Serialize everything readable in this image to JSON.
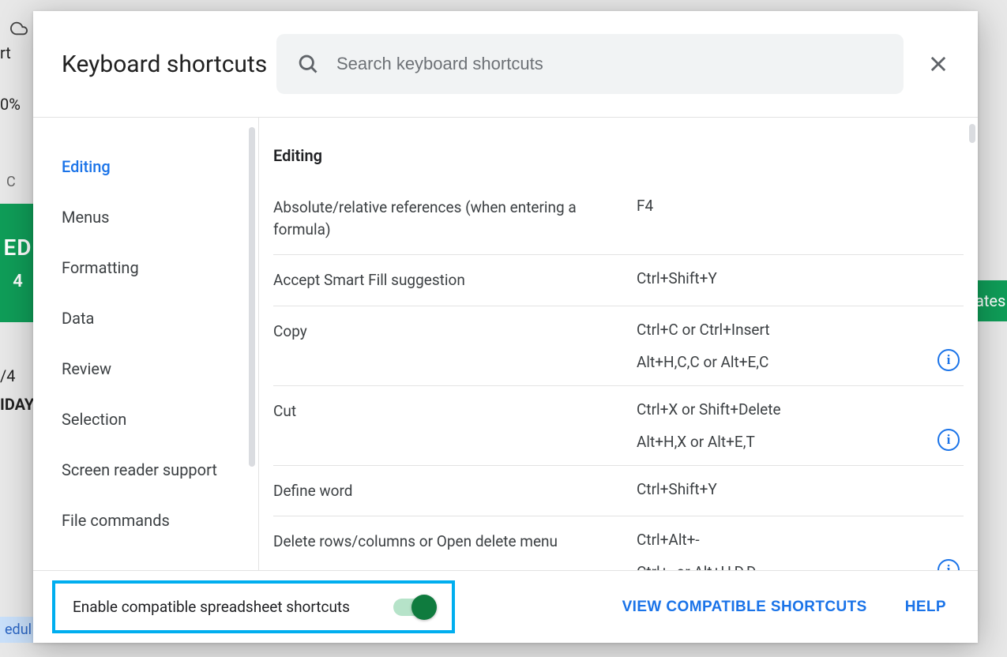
{
  "background": {
    "rt": "rt",
    "zoom": "0%",
    "ed": "ED",
    "num4": "4",
    "ates": "ates",
    "frac": "/4",
    "day": "IDAY",
    "c": "C",
    "edul": "edul"
  },
  "dialog": {
    "title": "Keyboard shortcuts",
    "search_placeholder": "Search keyboard shortcuts"
  },
  "sidebar": {
    "items": [
      {
        "label": "Editing",
        "active": true
      },
      {
        "label": "Menus",
        "active": false
      },
      {
        "label": "Formatting",
        "active": false
      },
      {
        "label": "Data",
        "active": false
      },
      {
        "label": "Review",
        "active": false
      },
      {
        "label": "Selection",
        "active": false
      },
      {
        "label": "Screen reader support",
        "active": false
      },
      {
        "label": "File commands",
        "active": false
      }
    ]
  },
  "content": {
    "section_title": "Editing",
    "shortcuts": [
      {
        "name": "Absolute/relative references (when entering a formula)",
        "keys": [
          "F4"
        ],
        "info": false
      },
      {
        "name": "Accept Smart Fill suggestion",
        "keys": [
          "Ctrl+Shift+Y"
        ],
        "info": false
      },
      {
        "name": "Copy",
        "keys": [
          "Ctrl+C or Ctrl+Insert",
          "Alt+H,C,C or Alt+E,C"
        ],
        "info": true
      },
      {
        "name": "Cut",
        "keys": [
          "Ctrl+X or Shift+Delete",
          "Alt+H,X or Alt+E,T"
        ],
        "info": true
      },
      {
        "name": "Define word",
        "keys": [
          "Ctrl+Shift+Y"
        ],
        "info": false
      },
      {
        "name": "Delete rows/columns or Open delete menu",
        "keys": [
          "Ctrl+Alt+-",
          "Ctrl+- or Alt+H,D,D"
        ],
        "info": true
      }
    ]
  },
  "footer": {
    "toggle_label": "Enable compatible spreadsheet shortcuts",
    "view_compatible": "VIEW COMPATIBLE SHORTCUTS",
    "help": "HELP"
  }
}
